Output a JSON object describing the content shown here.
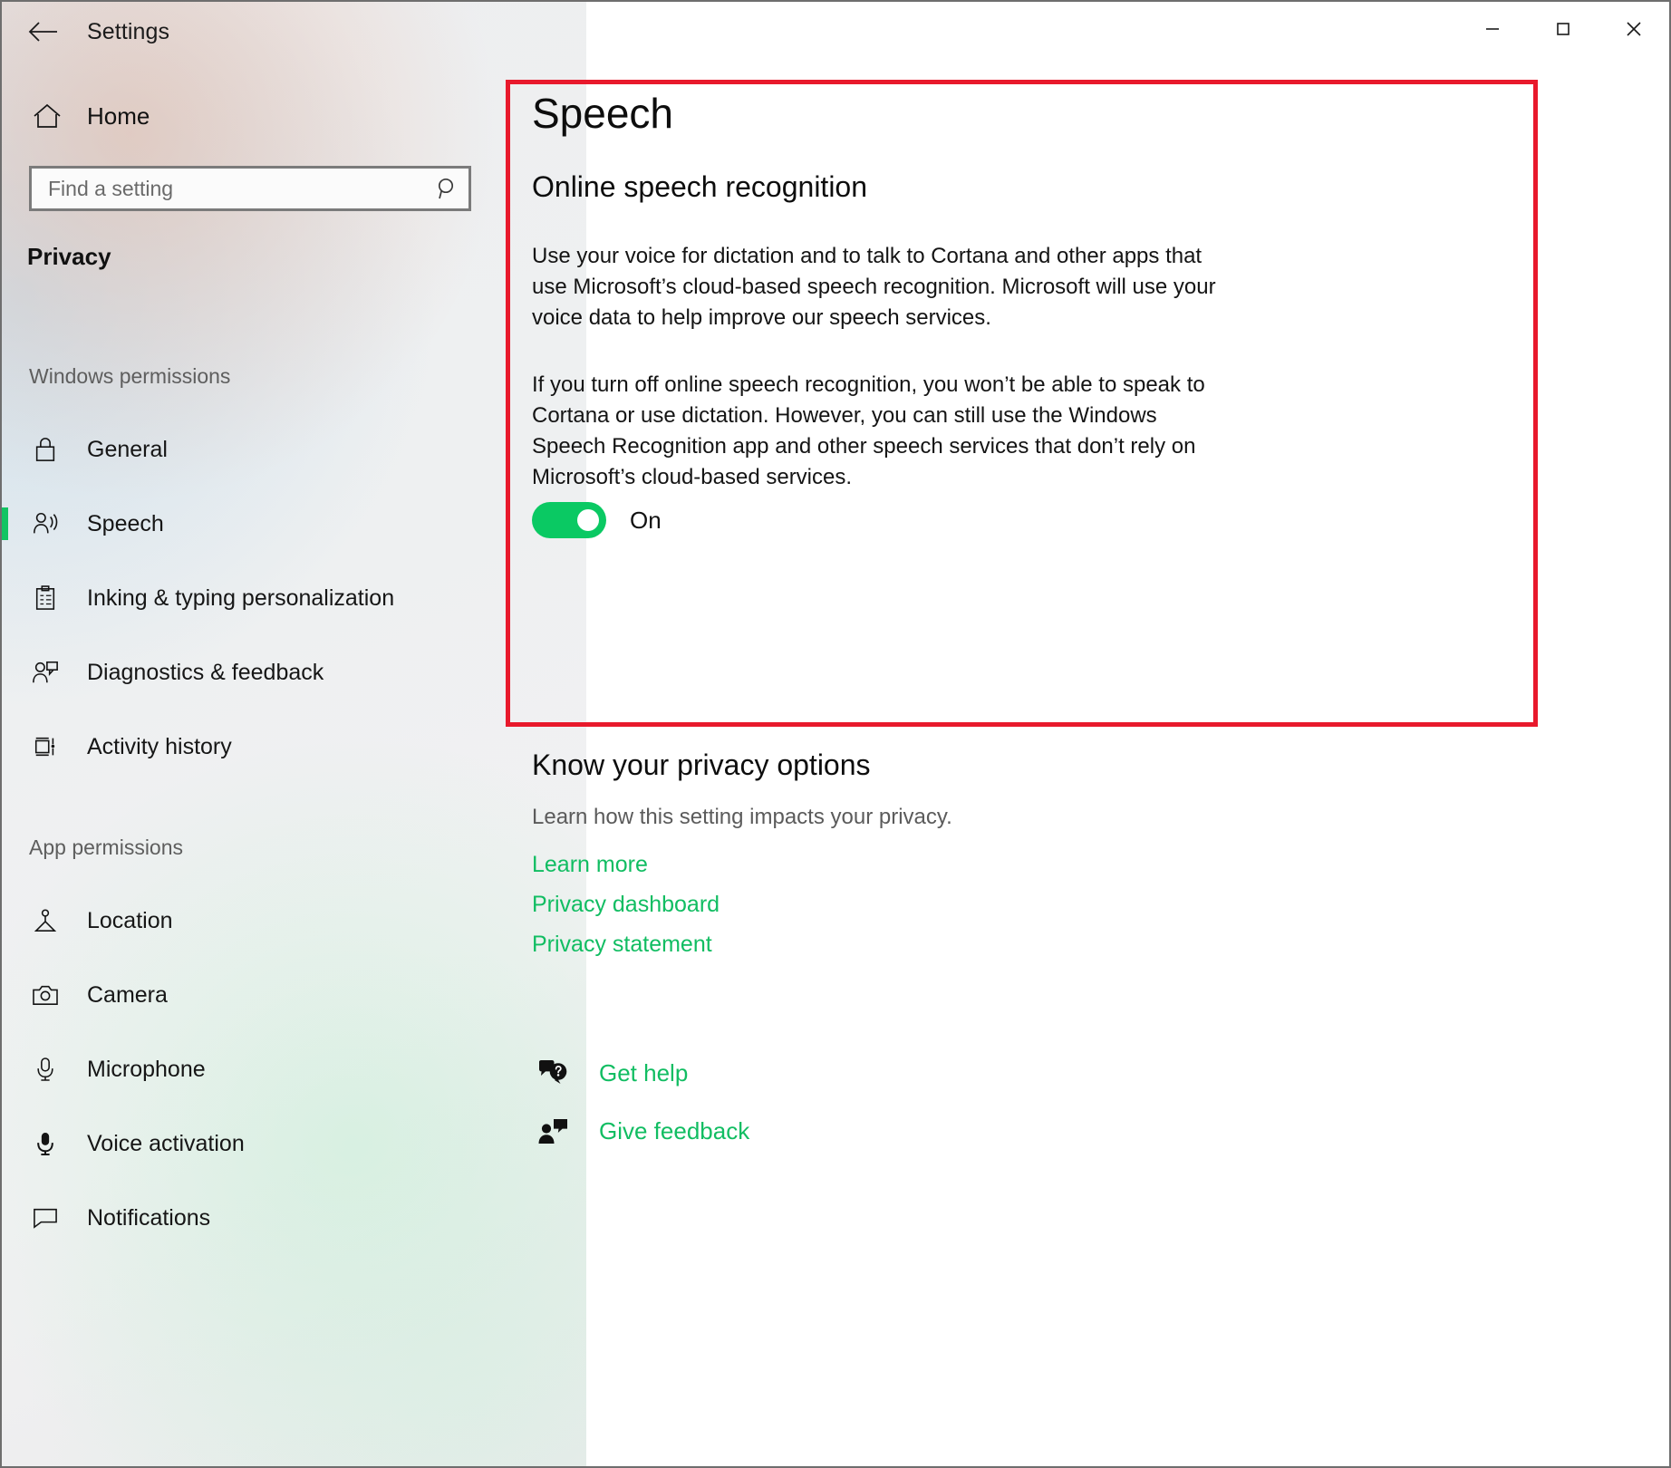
{
  "window": {
    "title": "Settings",
    "back_icon": "back-arrow-icon",
    "controls": {
      "minimize": "minimize-icon",
      "maximize": "maximize-icon",
      "close": "close-icon"
    }
  },
  "sidebar": {
    "home": {
      "label": "Home",
      "icon": "home-icon"
    },
    "search": {
      "placeholder": "Find a setting",
      "value": "",
      "icon": "search-icon"
    },
    "category": "Privacy",
    "groups": [
      {
        "header": "Windows permissions",
        "items": [
          {
            "label": "General",
            "icon": "lock-icon",
            "selected": false
          },
          {
            "label": "Speech",
            "icon": "speech-person-icon",
            "selected": true
          },
          {
            "label": "Inking & typing personalization",
            "icon": "clipboard-icon",
            "selected": false
          },
          {
            "label": "Diagnostics & feedback",
            "icon": "person-feedback-icon",
            "selected": false
          },
          {
            "label": "Activity history",
            "icon": "activity-history-icon",
            "selected": false
          }
        ]
      },
      {
        "header": "App permissions",
        "items": [
          {
            "label": "Location",
            "icon": "location-pin-icon",
            "selected": false
          },
          {
            "label": "Camera",
            "icon": "camera-icon",
            "selected": false
          },
          {
            "label": "Microphone",
            "icon": "microphone-icon",
            "selected": false
          },
          {
            "label": "Voice activation",
            "icon": "voice-activation-icon",
            "selected": false
          },
          {
            "label": "Notifications",
            "icon": "notification-bubble-icon",
            "selected": false
          }
        ]
      }
    ]
  },
  "main": {
    "page_title": "Speech",
    "section_title": "Online speech recognition",
    "paragraph_1": "Use your voice for dictation and to talk to Cortana and other apps that use Microsoft’s cloud-based speech recognition. Microsoft will use your voice data to help improve our speech services.",
    "paragraph_2": "If you turn off online speech recognition, you won’t be able to speak to Cortana or use dictation. However, you can still use the Windows Speech Recognition app and other speech services that don’t rely on Microsoft’s cloud-based services.",
    "toggle": {
      "label": "On",
      "state": "on"
    },
    "privacy_options": {
      "title": "Know your privacy options",
      "subtitle": "Learn how this setting impacts your privacy.",
      "links": [
        {
          "label": "Learn more"
        },
        {
          "label": "Privacy dashboard"
        },
        {
          "label": "Privacy statement"
        }
      ]
    },
    "helpers": [
      {
        "label": "Get help",
        "icon": "help-bubble-icon"
      },
      {
        "label": "Give feedback",
        "icon": "feedback-person-icon"
      }
    ]
  },
  "colors": {
    "accent_green": "#11bd62",
    "toggle_green": "#0ac963",
    "highlight_red": "#e8192c",
    "selection_bar": "#12c463"
  }
}
